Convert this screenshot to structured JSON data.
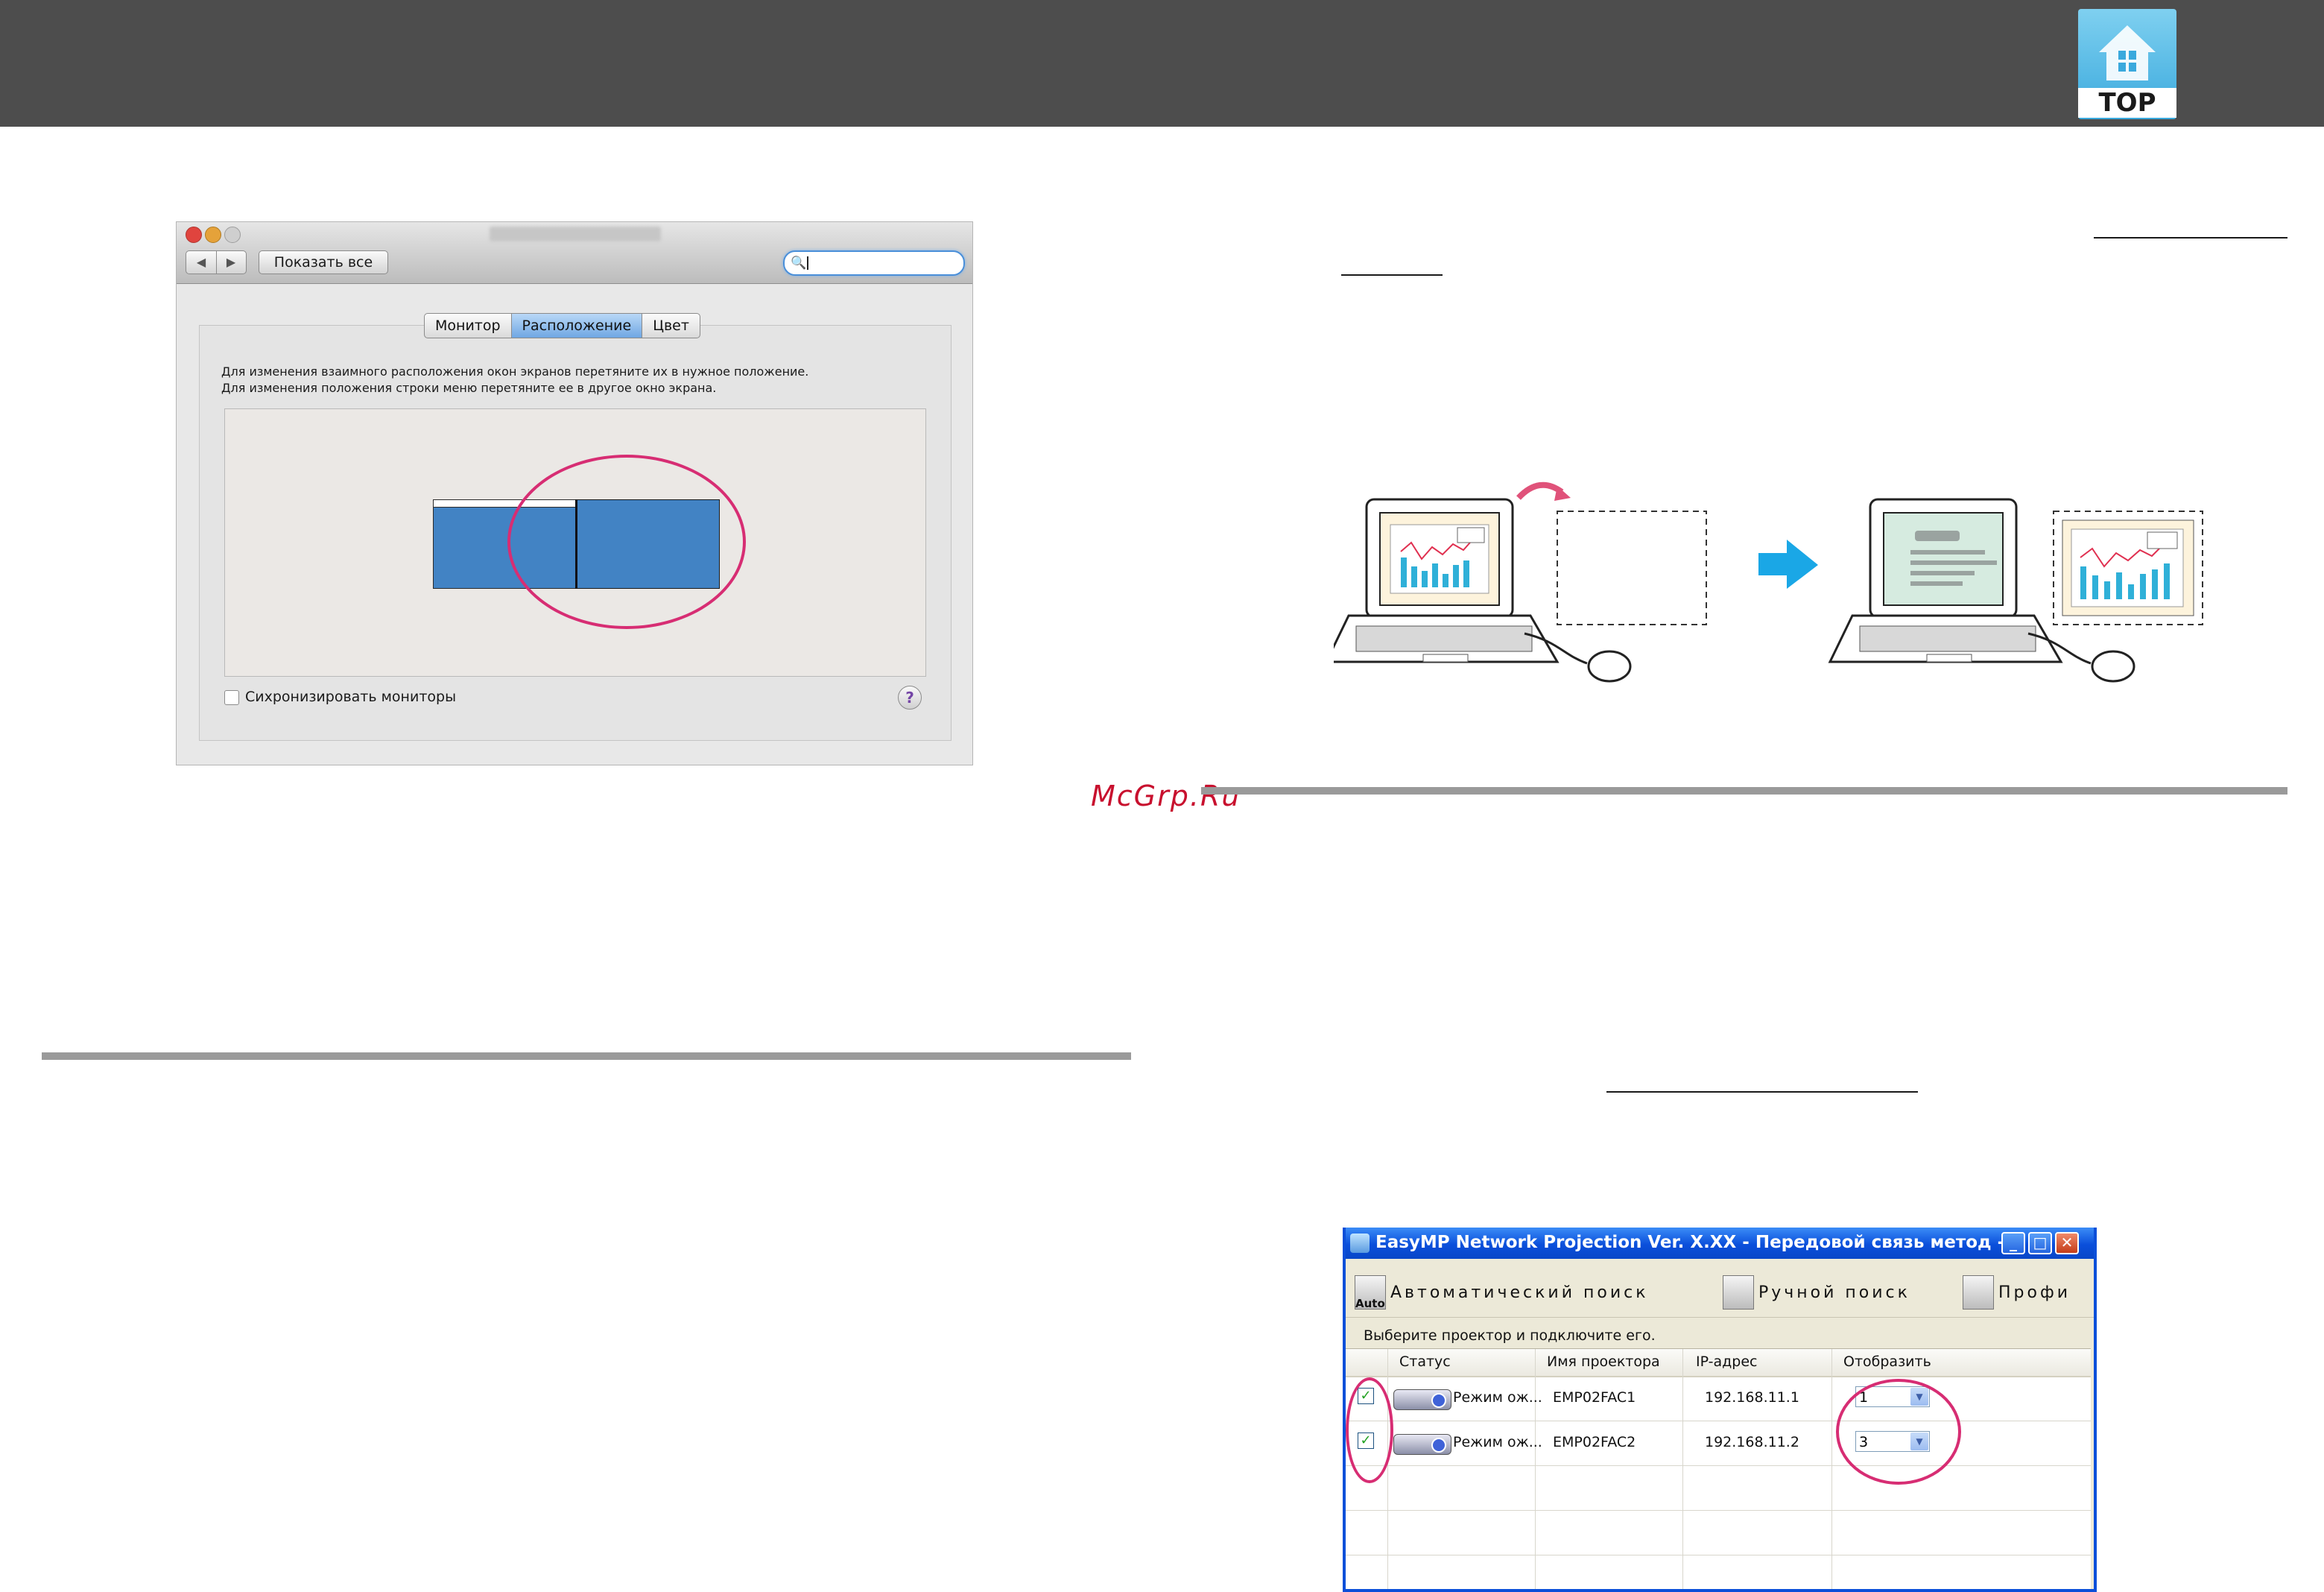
{
  "header": {
    "top_button_label": "TOP"
  },
  "mac_prefs": {
    "show_all_label": "Показать все",
    "tabs": [
      "Монитор",
      "Расположение",
      "Цвет"
    ],
    "active_tab_index": 1,
    "instructions": [
      "Для изменения взаимного расположения окон экранов перетяните их в нужное положение.",
      "Для изменения положения строки меню перетяните ее в другое окно экрана."
    ],
    "mirror_label": "Сихронизировать мониторы",
    "mirror_checked": false,
    "help_label": "?"
  },
  "watermark": "McGrp.Ru",
  "easymp": {
    "title": "EasyMP Network Projection Ver. X.XX - Передовой связь метод -",
    "toolbar": {
      "auto_icon_text": "Auto",
      "auto_search": "Автоматический поиск",
      "manual_search": "Ручной поиск",
      "profile": "Профи"
    },
    "prompt": "Выберите проектор и подключите его.",
    "columns": [
      "Статус",
      "Имя проектора",
      "IP-адрес",
      "Отобразить"
    ],
    "rows": [
      {
        "checked": true,
        "status": "Режим ож...",
        "name": "EMP02FAC1",
        "ip": "192.168.11.1",
        "display": "1"
      },
      {
        "checked": true,
        "status": "Режим ож...",
        "name": "EMP02FAC2",
        "ip": "192.168.11.2",
        "display": "3"
      }
    ]
  }
}
